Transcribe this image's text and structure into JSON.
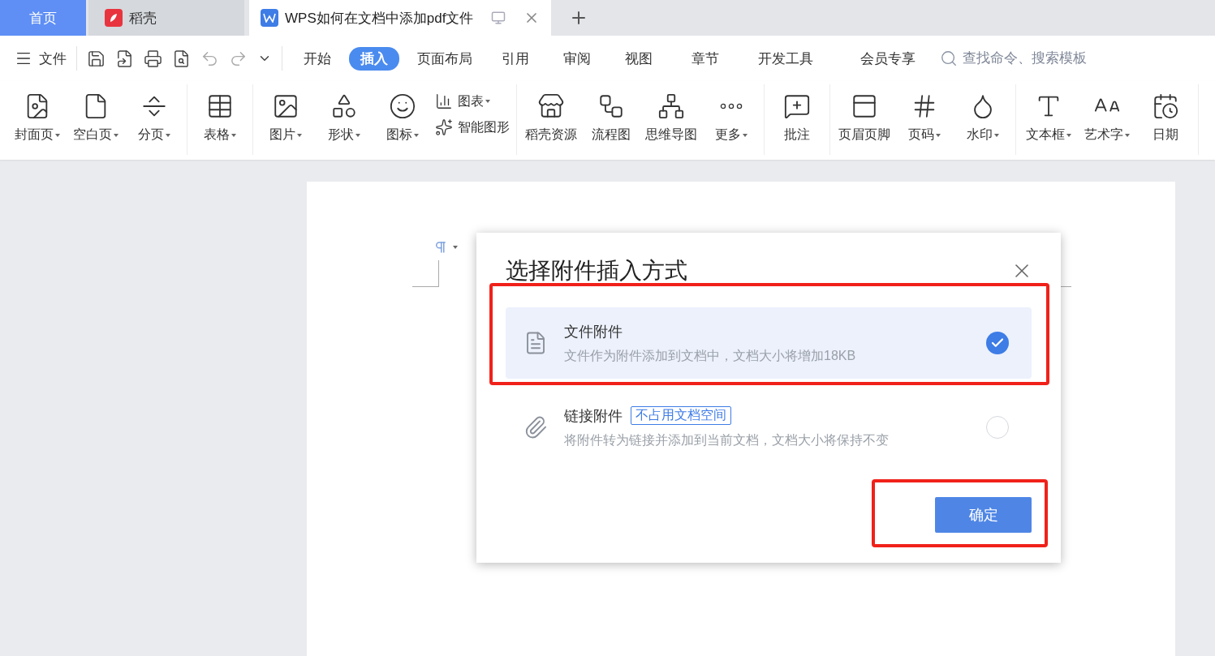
{
  "tabs": [
    {
      "label": "首页",
      "kind": "home",
      "selected": false
    },
    {
      "label": "稻壳",
      "kind": "app",
      "selected": false
    },
    {
      "label": "WPS如何在文档中添加pdf文件",
      "kind": "doc",
      "selected": true
    }
  ],
  "menu": {
    "file_label": "文件",
    "tabs": [
      {
        "label": "开始",
        "selected": false
      },
      {
        "label": "插入",
        "selected": true
      },
      {
        "label": "页面布局",
        "selected": false
      },
      {
        "label": "引用",
        "selected": false
      },
      {
        "label": "审阅",
        "selected": false
      },
      {
        "label": "视图",
        "selected": false
      },
      {
        "label": "章节",
        "selected": false
      },
      {
        "label": "开发工具",
        "selected": false
      },
      {
        "label": "会员专享",
        "selected": false
      }
    ],
    "search": {
      "placeholder": "查找命令、搜索模板"
    }
  },
  "ribbon": [
    {
      "items": [
        {
          "label": "封面页",
          "dropdown": true,
          "kind": "large"
        },
        {
          "label": "空白页",
          "dropdown": true,
          "kind": "large"
        },
        {
          "label": "分页",
          "dropdown": true,
          "kind": "large"
        }
      ]
    },
    {
      "items": [
        {
          "label": "表格",
          "dropdown": true,
          "kind": "large"
        }
      ]
    },
    {
      "items": [
        {
          "label": "图片",
          "dropdown": true,
          "kind": "large"
        },
        {
          "label": "形状",
          "dropdown": true,
          "kind": "large"
        },
        {
          "label": "图标",
          "dropdown": true,
          "kind": "large"
        },
        {
          "label": "图表",
          "dropdown": true,
          "kind": "small"
        },
        {
          "label": "智能图形",
          "dropdown": false,
          "kind": "small"
        }
      ]
    },
    {
      "items": [
        {
          "label": "稻壳资源",
          "dropdown": false,
          "kind": "large"
        },
        {
          "label": "流程图",
          "dropdown": false,
          "kind": "large"
        },
        {
          "label": "思维导图",
          "dropdown": false,
          "kind": "large"
        },
        {
          "label": "更多",
          "dropdown": true,
          "kind": "large"
        }
      ]
    },
    {
      "items": [
        {
          "label": "批注",
          "dropdown": false,
          "kind": "large"
        }
      ]
    },
    {
      "items": [
        {
          "label": "页眉页脚",
          "dropdown": false,
          "kind": "large"
        },
        {
          "label": "页码",
          "dropdown": true,
          "kind": "large"
        },
        {
          "label": "水印",
          "dropdown": true,
          "kind": "large"
        }
      ]
    },
    {
      "items": [
        {
          "label": "文本框",
          "dropdown": true,
          "kind": "large"
        },
        {
          "label": "艺术字",
          "dropdown": true,
          "kind": "large"
        },
        {
          "label": "日期",
          "dropdown": false,
          "kind": "large"
        }
      ]
    }
  ],
  "dialog": {
    "title": "选择附件插入方式",
    "options": [
      {
        "title": "文件附件",
        "description": "文件作为附件添加到文档中，文档大小将增加18KB",
        "selected": true,
        "highlighted": true
      },
      {
        "title": "链接附件",
        "badge": "不占用文档空间",
        "description": "将附件转为链接并添加到当前文档，文档大小将保持不变",
        "selected": false,
        "highlighted": false
      }
    ],
    "confirm": {
      "label": "确定",
      "highlighted": true
    }
  }
}
